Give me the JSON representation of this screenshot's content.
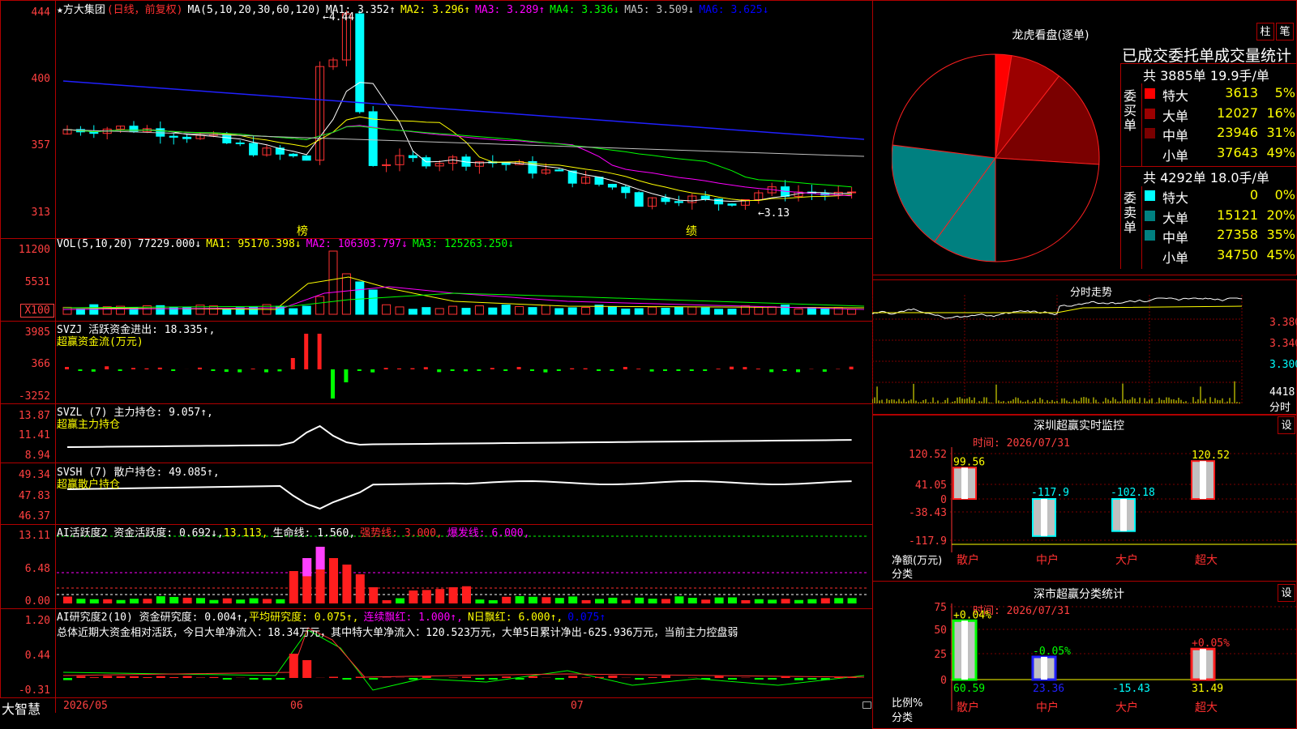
{
  "main": {
    "title": "★方大集团",
    "period": "(日线，前复权)",
    "ma_label": "MA(5,10,20,30,60,120)",
    "ma": [
      {
        "t": "MA1: 3.352↑",
        "c": "#ffffff"
      },
      {
        "t": "MA2: 3.296↑",
        "c": "#ffff00"
      },
      {
        "t": "MA3: 3.289↑",
        "c": "#ff00ff"
      },
      {
        "t": "MA4: 3.336↓",
        "c": "#00ff00"
      },
      {
        "t": "MA5: 3.509↓",
        "c": "#c0c0c0"
      },
      {
        "t": "MA6: 3.625↓",
        "c": "#0000ff"
      }
    ],
    "y_ticks": [
      "444",
      "400",
      "357",
      "313"
    ],
    "high_label": "4.44",
    "low_label": "3.13",
    "mark_bang": "榜",
    "mark_ji": "绩"
  },
  "vol": {
    "label": "VOL(5,10,20)",
    "value": "77229.000↓",
    "ma": [
      {
        "t": "MA1: 95170.398↓",
        "c": "#ffff00"
      },
      {
        "t": "MA2: 106303.797↓",
        "c": "#ff00ff"
      },
      {
        "t": "MA3: 125263.250↓",
        "c": "#00ff00"
      }
    ],
    "y_ticks": [
      "11200",
      "5531",
      "X100"
    ]
  },
  "svzj": {
    "label": "SVZJ  活跃资金进出: 18.335↑,",
    "sub": "超赢资金流(万元)",
    "y_ticks": [
      "3985",
      "366",
      "-3252"
    ]
  },
  "svzl": {
    "label": "SVZL (7) 主力持仓: 9.057↑,",
    "sub": "超赢主力持仓",
    "y_ticks": [
      "13.87",
      "11.41",
      "8.94"
    ]
  },
  "svsh": {
    "label": "SVSH (7) 散户持仓: 49.085↑,",
    "sub": "超赢散户持仓",
    "y_ticks": [
      "49.34",
      "47.83",
      "46.37"
    ]
  },
  "ai1": {
    "label": "AI活跃度2 资金活跃度: 0.692↓,",
    "v2": "13.113,",
    "v3": "生命线: 1.560,",
    "v4": "强势线: 3.000,",
    "v5": "爆发线: 6.000,",
    "y_ticks": [
      "13.11",
      "6.48",
      "0.00"
    ]
  },
  "ai2": {
    "label": "AI研究度2(10) 资金研究度: 0.004↑,",
    "v2": "平均研究度: 0.075↑,",
    "v3": "连续飘红: 1.000↑,",
    "v4": "N日飘红: 6.000↑,",
    "v5": "0.075↑",
    "summary": "总体近期大资金相对活跃，今日大单净流入：18.34万元，其中特大单净流入：120.523万元，大单5日累计净出-625.936万元，当前主力控盘弱",
    "y_ticks": [
      "1.20",
      "0.44",
      "-0.31"
    ]
  },
  "bottom": {
    "brand": "大智慧",
    "dates": [
      "2026/05",
      "06",
      "07"
    ]
  },
  "right": {
    "lhb_title": "龙虎看盘(逐单)",
    "btn1": "柱",
    "btn2": "笔",
    "stat_title": "已成交委托单成交量统计",
    "buy_head": "共 3885单 19.9手/单",
    "buy_label": "委买单",
    "buy_rows": [
      {
        "name": "特大",
        "vol": "3613",
        "pct": "5%",
        "color": "#ff0000"
      },
      {
        "name": "大单",
        "vol": "12027",
        "pct": "16%",
        "color": "#9b0000"
      },
      {
        "name": "中单",
        "vol": "23946",
        "pct": "31%",
        "color": "#7a0000"
      },
      {
        "name": "小单",
        "vol": "37643",
        "pct": "49%",
        "color": "#000000"
      }
    ],
    "sell_head": "共 4292单 18.0手/单",
    "sell_label": "委卖单",
    "sell_rows": [
      {
        "name": "特大",
        "vol": "0",
        "pct": "0%",
        "color": "#00ffff"
      },
      {
        "name": "大单",
        "vol": "15121",
        "pct": "20%",
        "color": "#008080"
      },
      {
        "name": "中单",
        "vol": "27358",
        "pct": "35%",
        "color": "#008080"
      },
      {
        "name": "小单",
        "vol": "34750",
        "pct": "45%",
        "color": "#000000"
      }
    ],
    "fs_title": "分时走势",
    "fs_ticks": [
      "3.380",
      "3.340",
      "3.300",
      "4418"
    ],
    "fs_unit": "分时",
    "sz_title": "深圳超赢实时监控",
    "sz_time": "时间: 2026/07/31",
    "sz_btn": "设",
    "sz_ticks": [
      "120.52",
      "41.05",
      "0",
      "-38.43",
      "-117.9"
    ],
    "sz_values": [
      "99.56",
      "-117.9",
      "-102.18",
      "120.52"
    ],
    "sz_axis_label1": "净额(万元)",
    "sz_axis_label2": "分类",
    "sz_cats": [
      "散户",
      "中户",
      "大户",
      "超大"
    ],
    "cls_title": "深市超赢分类统计",
    "cls_time": "时间: 2026/07/31",
    "cls_btn": "设",
    "cls_ticks": [
      "75",
      "50",
      "25",
      "0"
    ],
    "cls_top": [
      "+0.04%",
      "-0.05%",
      "+0.05%"
    ],
    "cls_bottom": [
      "60.59",
      "23.36",
      "-15.43",
      "31.49"
    ],
    "cls_axis_label1": "比例%",
    "cls_axis_label2": "分类",
    "cls_cats": [
      "散户",
      "中户",
      "大户",
      "超大"
    ]
  }
}
